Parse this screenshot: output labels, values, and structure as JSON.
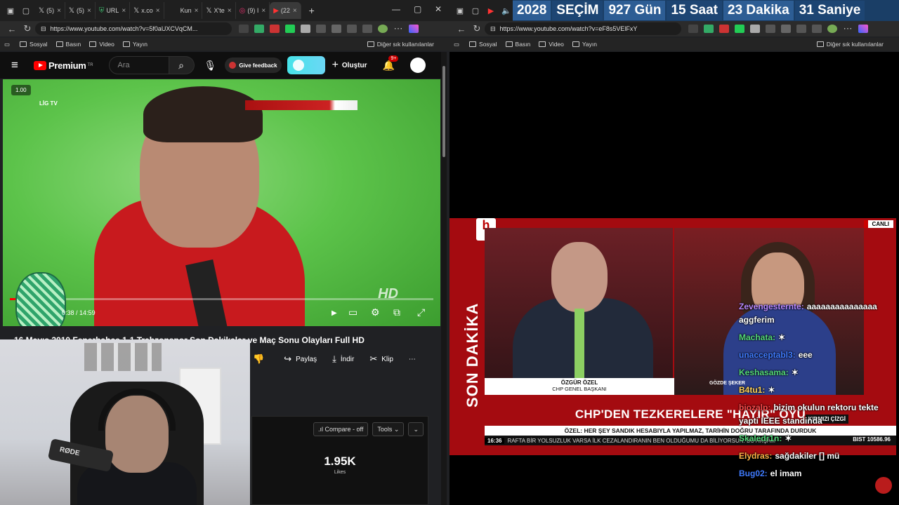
{
  "left_browser": {
    "tabs": [
      {
        "label": "",
        "icon": "x-icon"
      },
      {
        "label": "(5)",
        "icon": "x-icon"
      },
      {
        "label": "(5)",
        "icon": "x-icon"
      },
      {
        "label": "URL",
        "icon": "shield-icon"
      },
      {
        "label": "x.co",
        "icon": "x-icon"
      },
      {
        "label": "Kun",
        "icon": "page-icon"
      },
      {
        "label": "X'te",
        "icon": "x-icon"
      },
      {
        "label": "(9) I",
        "icon": "instagram-icon"
      },
      {
        "label": "(22",
        "icon": "youtube-icon",
        "active": true
      }
    ],
    "url": "https://www.youtube.com/watch?v=5f0aUXCVqCM...",
    "bookmarks": [
      "Sosyal",
      "Basın",
      "Video",
      "Yayın"
    ],
    "other_bookmarks": "Diğer sık kullanılanlar"
  },
  "youtube": {
    "logo_text": "Premium",
    "logo_country": "TR",
    "search_placeholder": "Ara",
    "feedback_label": "Give feedback",
    "create_label": "Oluştur",
    "notifications_badge": "9+",
    "player": {
      "speed": "1.00",
      "channel_logo": "LİG TV",
      "watermark": "HD",
      "current_time": "0:38",
      "duration": "14:59",
      "progress_fraction": 0.042
    },
    "video_title": "16 Mayıs 2010 Fenerbahçe 1-1 Trabzonspor Son Dakikalar ve Maç Sonu Olayları Full HD",
    "actions": {
      "share": "Paylaş",
      "download": "İndir",
      "clip": "Klip"
    },
    "analytics": {
      "compare": ".ıl Compare - off",
      "tools": "Tools",
      "metric_value": "1.95K",
      "metric_label": "Likes"
    }
  },
  "webcam": {
    "mic_brand": "RØDE"
  },
  "right_browser": {
    "url": "https://www.youtube.com/watch?v=eF8s5VElFxY",
    "bookmarks": [
      "Sosyal",
      "Basın",
      "Video",
      "Yayın"
    ],
    "other_bookmarks": "Diğer sık kullanılanlar"
  },
  "countdown": {
    "year": "2028",
    "label": "SEÇİM",
    "days": "927 Gün",
    "hours": "15 Saat",
    "minutes": "23 Dakika",
    "seconds": "31 Saniye"
  },
  "news": {
    "channel": "h",
    "side_label": "SON DAKİKA",
    "live": "CANLI",
    "guest_name": "ÖZGÜR ÖZEL",
    "guest_role": "CHP GENEL BAŞKANI",
    "anchor_name": "GÖZDE ŞEKER",
    "headline": "CHP'DEN TEZKERELERE \"HAYIR\" OYU",
    "subline": "ÖZEL: HER ŞEY SANDIK HESABIYLA YAPILMAZ, TARİHİN DOĞRU TARAFINDA DURDUK",
    "program": "KIRMIZI ÇİZGİ",
    "clock": "16:36",
    "ticker": "RAFTA BİR YOLSUZLUK VARSA İLK CEZALANDIRANIN BEN OLDUĞUMU DA BİLİYORSUN. BU AKŞAM",
    "bist": "BIST 10586.96"
  },
  "chat": [
    {
      "user": "Zevengesternte:",
      "text": "aaaaaaaaaaaaaaa aggferim",
      "color": "#b889ff"
    },
    {
      "user": "Machata:",
      "text": "",
      "color": "#53d87a"
    },
    {
      "user": "unacceptabl3:",
      "text": "eee",
      "color": "#3f7bff"
    },
    {
      "user": "Keshasama:",
      "text": "",
      "color": "#53d87a"
    },
    {
      "user": "B4tu1:",
      "text": "",
      "color": "#ffd35c"
    },
    {
      "user": "biozalp:",
      "text": "bizim okulun rektoru tekte yapti IEEE standinda",
      "color": "#ff4d4d"
    },
    {
      "user": "Skaledr1n:",
      "text": "",
      "color": "#53d87a"
    },
    {
      "user": "Elydras:",
      "text": "sağdakiler [] mü",
      "color": "#ffb347"
    },
    {
      "user": "Bug02:",
      "text": "el imam",
      "color": "#3f7bff"
    }
  ]
}
